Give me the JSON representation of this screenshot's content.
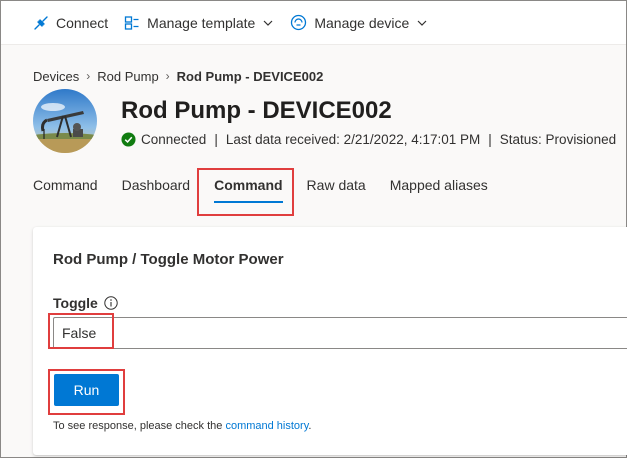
{
  "toolbar": {
    "connect_label": "Connect",
    "manage_template_label": "Manage template",
    "manage_device_label": "Manage device"
  },
  "breadcrumb": [
    "Devices",
    "Rod Pump",
    "Rod Pump - DEVICE002"
  ],
  "device": {
    "title": "Rod Pump - DEVICE002",
    "connection_status": "Connected",
    "last_data": "Last data received: 2/21/2022, 4:17:01 PM",
    "provision_status": "Status: Provisioned"
  },
  "tabs": [
    {
      "label": "Command",
      "active": false
    },
    {
      "label": "Dashboard",
      "active": false
    },
    {
      "label": "Command",
      "active": true
    },
    {
      "label": "Raw data",
      "active": false
    },
    {
      "label": "Mapped aliases",
      "active": false
    }
  ],
  "command_card": {
    "title": "Rod Pump / Toggle Motor Power",
    "field_label": "Toggle",
    "field_value": "False",
    "run_label": "Run",
    "hint_prefix": "To see response, please check the ",
    "hint_link": "command history",
    "hint_suffix": "."
  },
  "colors": {
    "accent": "#0078d4",
    "success": "#107c10",
    "highlight": "#e03e3e"
  },
  "icons": [
    "plug-icon",
    "template-icon",
    "device-icon",
    "chevron-down-icon",
    "check-circle-icon",
    "info-icon"
  ]
}
